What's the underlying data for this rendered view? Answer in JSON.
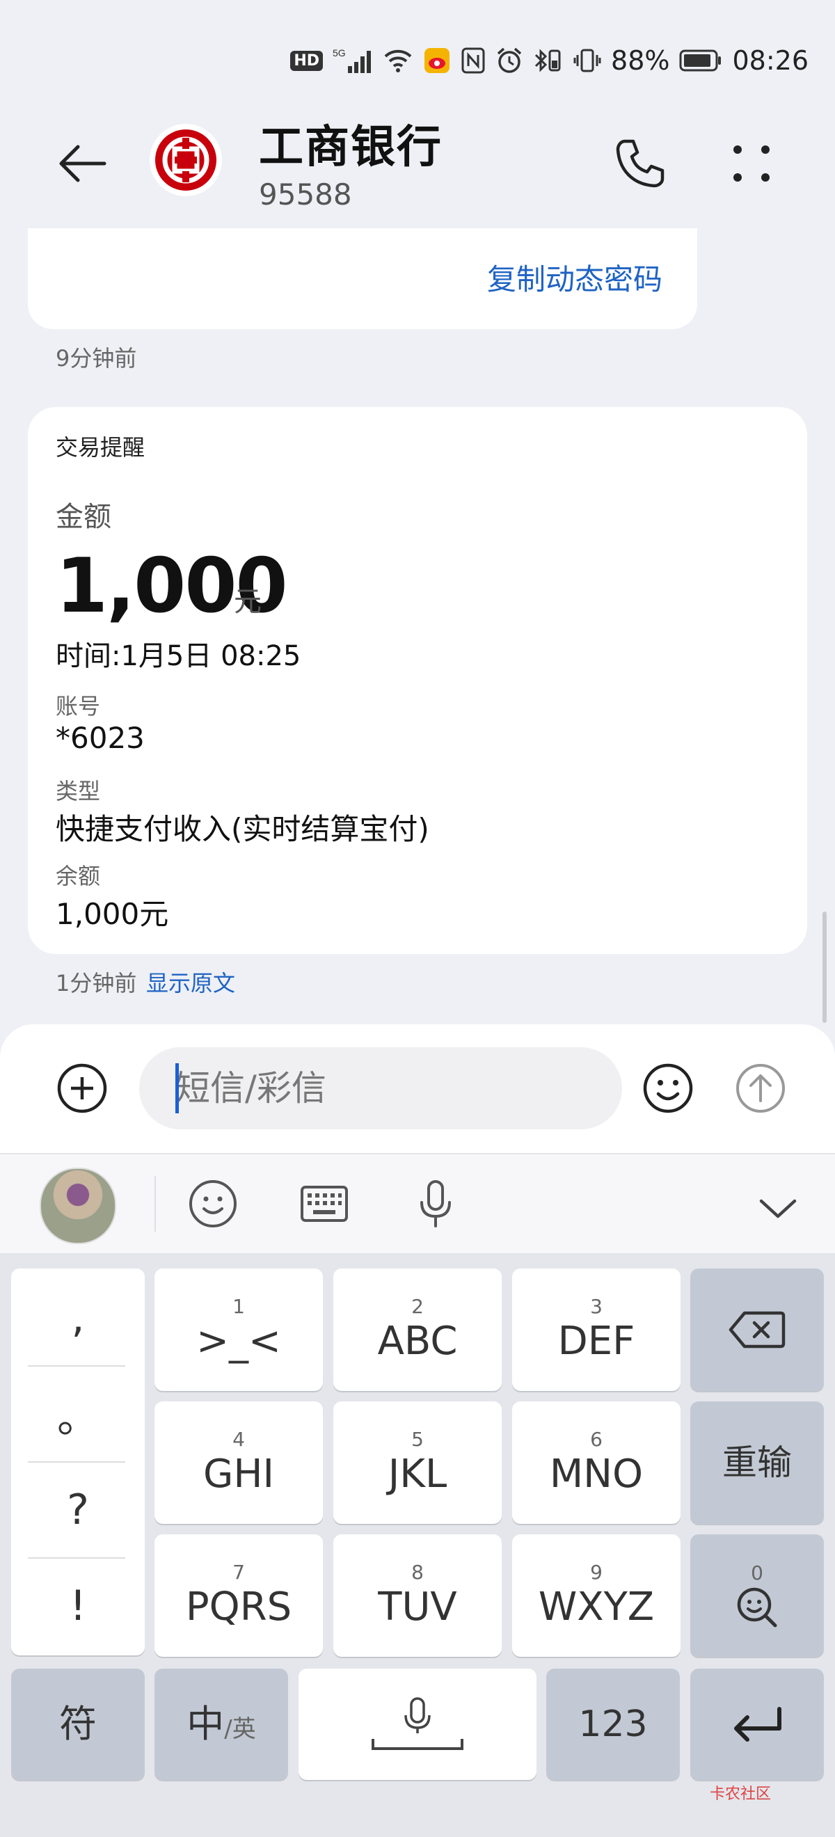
{
  "status_bar": {
    "battery": "88%",
    "time": "08:26",
    "hd": "HD",
    "net": "5G"
  },
  "header": {
    "title": "工商银行",
    "number": "95588"
  },
  "messages": {
    "prev": {
      "copy_link": "复制动态密码",
      "time": "9分钟前"
    },
    "current": {
      "card_title": "交易提醒",
      "amount_label": "金额",
      "amount": "1,000",
      "amount_unit": "元",
      "time_line": "时间:1月5日 08:25",
      "account_label": "账号",
      "account_value": "*6023",
      "type_label": "类型",
      "type_value": "快捷支付收入(实时结算宝付)",
      "balance_label": "余额",
      "balance_value": "1,000元",
      "time": "1分钟前",
      "show_original": "显示原文"
    }
  },
  "input": {
    "placeholder": "短信/彩信"
  },
  "keyboard": {
    "punct": [
      ",",
      "。",
      "?",
      "!"
    ],
    "rows": [
      [
        {
          "num": "1",
          "label": ">_<"
        },
        {
          "num": "2",
          "label": "ABC"
        },
        {
          "num": "3",
          "label": "DEF"
        }
      ],
      [
        {
          "num": "4",
          "label": "GHI"
        },
        {
          "num": "5",
          "label": "JKL"
        },
        {
          "num": "6",
          "label": "MNO"
        }
      ],
      [
        {
          "num": "7",
          "label": "PQRS"
        },
        {
          "num": "8",
          "label": "TUV"
        },
        {
          "num": "9",
          "label": "WXYZ"
        }
      ]
    ],
    "reset": "重输",
    "zero_num": "0",
    "symbol": "符",
    "lang_main": "中",
    "lang_alt": "/英",
    "num_mode": "123"
  },
  "watermark": "卡农社区",
  "colors": {
    "link": "#1f63c4",
    "icbc_red": "#c7000b",
    "caret": "#1a5fd6"
  }
}
